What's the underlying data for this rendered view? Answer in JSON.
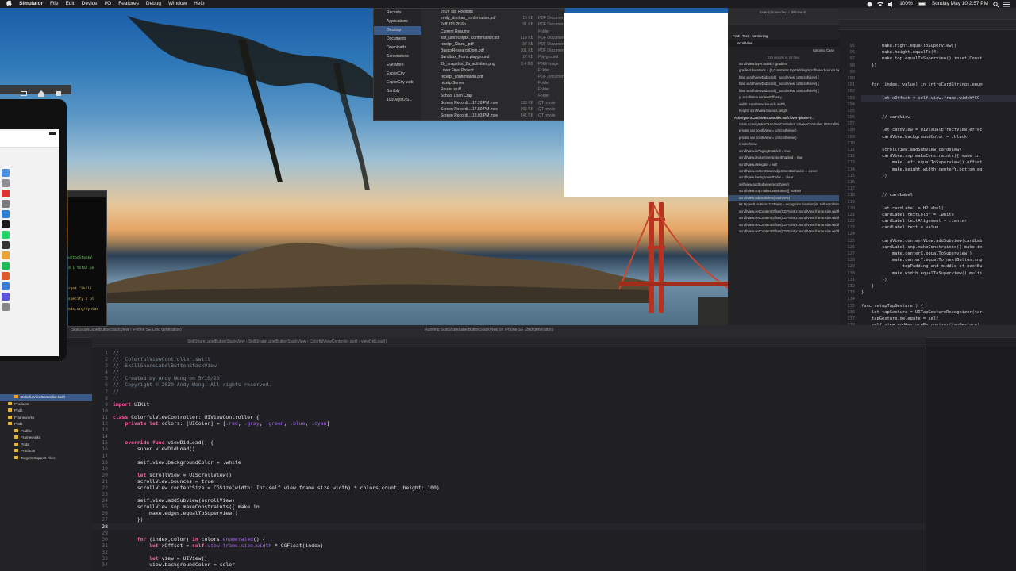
{
  "menubar": {
    "apple": "",
    "app_name": "Simulator",
    "items": [
      "File",
      "Edit",
      "Device",
      "I/O",
      "Features",
      "Debug",
      "Window",
      "Help"
    ],
    "battery": "100%",
    "clock": "Sunday May 10  2:57 PM"
  },
  "finder": {
    "sidebar": [
      "Recents",
      "Applications",
      "Desktop",
      "Documents",
      "Downloads",
      "Screenshots",
      "EverMore",
      "ExplorCity",
      "ExplorCity-web",
      "Baritbly",
      "100DaysOfS..."
    ],
    "selected": "Desktop",
    "files": [
      {
        "name": "2019 Tax Receipts",
        "size": "",
        "kind": ""
      },
      {
        "name": "emily_doohan_confirmation.pdf",
        "size": "15 KB",
        "kind": "PDF Document"
      },
      {
        "name": "2aff1f15.2f16b",
        "size": "51 KB",
        "kind": "PDF Document"
      },
      {
        "name": "Current Resume",
        "size": "",
        "kind": "Folder"
      },
      {
        "name": "sist_umreceiptx...confirmation.pdf",
        "size": "119 KB",
        "kind": "PDF Document"
      },
      {
        "name": "receipt_Cbiza_.pdf",
        "size": "57 KB",
        "kind": "PDF Document"
      },
      {
        "name": "BasicsResearchDoin.pdf",
        "size": "101 KB",
        "kind": "PDF Document"
      },
      {
        "name": "Sandbox_Frans.playground",
        "size": "17 KB",
        "kind": "Playground"
      },
      {
        "name": "2b_snapshot_2a_activities.png",
        "size": "3.4 MB",
        "kind": "PNG image"
      },
      {
        "name": "Lover Final Project",
        "size": "",
        "kind": "Folder"
      },
      {
        "name": "receipt_confirmation.pdf",
        "size": "",
        "kind": "PDF Document"
      },
      {
        "name": "receiptServer",
        "size": "",
        "kind": "Folder"
      },
      {
        "name": "Router stuff",
        "size": "",
        "kind": "Folder"
      },
      {
        "name": "School Loan Crap",
        "size": "",
        "kind": "Folder"
      },
      {
        "name": "Screen Recordi....17.28 PM.mov",
        "size": "533 KB",
        "kind": "QT movie"
      },
      {
        "name": "Screen Recordi....17.50 PM.mov",
        "size": "995 KB",
        "kind": "QT movie"
      },
      {
        "name": "Screen Recordi....18.03 PM.mov",
        "size": "341 KB",
        "kind": "QT movie"
      },
      {
        "name": "Screen Recordi....18.23 PM.mov",
        "size": "265 KB",
        "kind": "QT movie"
      }
    ]
  },
  "xcode_right": {
    "scheme": "lover-iphone-dev",
    "device": "iPhone 8",
    "find_label": "Find",
    "find_modes": [
      "Text",
      "Containing"
    ],
    "query": "scrollView",
    "ignoring_case": "Ignoring Case",
    "results_count": "225 results in 19 files",
    "results": [
      "scrollView.layer.mask = gradient",
      "gradient.locations = [0,Constants.topPadding/scrollView.bounds.height as NSNumber,0.1,0.8,1]",
      "func scrollViewDidScroll(_ scrollView: UIScrollView) {",
      "func scrollViewDidScroll(_ scrollView: UIScrollView) {",
      "func scrollViewDidScroll(_ scrollView: UIScrollView) {",
      "y: scrollView.contentOffset.y,",
      "width: scrollView.bounds.width,",
      "height: scrollView.bounds.height",
      "ActivityIntroCardViewController.swift  lover-iphone-s...",
      "class ActivityIntroCardViewController: UIViewController, UIScrollViewDelegate, UIGestureRecognizerDelegate {",
      "private var scrollView = UIScrollView()",
      "private var scrollView = UIScrollView()",
      "// scrollView",
      "scrollView.isPagingEnabled = true",
      "scrollView.isUserInteractionEnabled = true",
      "scrollView.delegate = self",
      "scrollView.contentInsetAdjustmentBehavior = .never",
      "scrollView.backgroundColor = .clear",
      "self.view.addSubview(scrollView)",
      "scrollView.snp.makeConstraints({ make in",
      "scrollView.addSubview(cardView)",
      "let tappedLocation: CGPoint = recognizer.location(in: self.scrollView)",
      "scrollView.setContentOffset(CGPoint(x: scrollView.frame.size.width * CGFloat(currentIndex + 1), y: 0), animated: true)",
      "scrollView.setContentOffset(CGPoint(x: scrollView.frame.size.width * CGFloat(currentIndex - 1), y: 0), animated: true)",
      "scrollView.setContentOffset(CGPoint(x: scrollView.frame.size.width * CGFloat(currentIndex + 1), y: 0), animated: true)",
      "scrollView.setContentOffset(CGPoint(x: scrollView.frame.size.width * CGFloat(currentIndex + 1), y: 0))"
    ],
    "code_lines": [
      {
        "n": "95",
        "t": "        make.right.equalToSuperview()"
      },
      {
        "n": "96",
        "t": "        make.height.equalTo(4)"
      },
      {
        "n": "97",
        "t": "        make.top.equalToSuperview().inset(Const"
      },
      {
        "n": "98",
        "t": "    })"
      },
      {
        "n": "99",
        "t": ""
      },
      {
        "n": "100",
        "t": ""
      },
      {
        "n": "101",
        "t": "    for (index, value) in introCardStrings.enum"
      },
      {
        "n": "102",
        "t": ""
      },
      {
        "n": "103",
        "t": "        let xOffset = self.view.frame.width*CG"
      },
      {
        "n": "104",
        "t": ""
      },
      {
        "n": "105",
        "t": ""
      },
      {
        "n": "106",
        "t": "        // cardView"
      },
      {
        "n": "107",
        "t": ""
      },
      {
        "n": "108",
        "t": "        let cardView = UIVisualEffectView(effec"
      },
      {
        "n": "109",
        "t": "        cardView.backgroundColor = .black"
      },
      {
        "n": "110",
        "t": ""
      },
      {
        "n": "111",
        "t": "        scrollView.addSubview(cardView)"
      },
      {
        "n": "112",
        "t": "        cardView.snp.makeConstraints({ make in"
      },
      {
        "n": "113",
        "t": "            make.left.equalToSuperview().offset"
      },
      {
        "n": "114",
        "t": "            make.height.width.centerY.bottom.eq"
      },
      {
        "n": "115",
        "t": "        })"
      },
      {
        "n": "116",
        "t": ""
      },
      {
        "n": "117",
        "t": ""
      },
      {
        "n": "118",
        "t": "        // cardLabel"
      },
      {
        "n": "119",
        "t": ""
      },
      {
        "n": "120",
        "t": "        let cardLabel = H2Label()"
      },
      {
        "n": "121",
        "t": "        cardLabel.textColor = .white"
      },
      {
        "n": "122",
        "t": "        cardLabel.textAlignment = .center"
      },
      {
        "n": "123",
        "t": "        cardLabel.text = value"
      },
      {
        "n": "124",
        "t": ""
      },
      {
        "n": "125",
        "t": "        cardView.contentView.addSubview(cardLab"
      },
      {
        "n": "126",
        "t": "        cardLabel.snp.makeConstraints({ make in"
      },
      {
        "n": "127",
        "t": "            make.centerX.equalToSuperview()"
      },
      {
        "n": "128",
        "t": "            make.centerY.equalTo(nextButton.snp"
      },
      {
        "n": "129",
        "t": "                topPadding and middle of nextBu"
      },
      {
        "n": "130",
        "t": "            make.width.equalToSuperview().multi"
      },
      {
        "n": "131",
        "t": "        })"
      },
      {
        "n": "132",
        "t": "    }"
      },
      {
        "n": "133",
        "t": "}"
      },
      {
        "n": "134",
        "t": ""
      },
      {
        "n": "135",
        "t": "func setupTapGesture() {"
      },
      {
        "n": "136",
        "t": "    let tapGesture = UITapGestureRecognizer(tar"
      },
      {
        "n": "137",
        "t": "    tapGesture.delegate = self"
      },
      {
        "n": "138",
        "t": "    self.view.addGestureRecognizer(tapGesture)"
      }
    ]
  },
  "xcode_bottom": {
    "breadcrumb": [
      "SkillShareLabelButtonStackView",
      "SkillShareLabelButtonStackView",
      "ColorfulViewController.swift",
      "viewDidLoad()"
    ],
    "scheme": "SkillShareLabelButtonStackView",
    "device": "iPhone SE (2nd generation)",
    "status": "Running SkillShareLabelButtonStackView on iPhone SE (2nd generation)",
    "navigator": [
      {
        "label": "ColorfulViewController.swift",
        "indent": 1,
        "selected": true
      },
      {
        "label": "Products",
        "indent": 0,
        "selected": false
      },
      {
        "label": "Pods",
        "indent": 0,
        "selected": false
      },
      {
        "label": "Frameworks",
        "indent": 0,
        "selected": false
      },
      {
        "label": "Pods",
        "indent": 0,
        "selected": false
      },
      {
        "label": "Podfile",
        "indent": 1,
        "selected": false
      },
      {
        "label": "Frameworks",
        "indent": 1,
        "selected": false
      },
      {
        "label": "Pods",
        "indent": 1,
        "selected": false
      },
      {
        "label": "Products",
        "indent": 1,
        "selected": false
      },
      {
        "label": "Targets Support Files",
        "indent": 1,
        "selected": false
      }
    ],
    "current_line": "28",
    "code_lines": [
      {
        "n": "1",
        "t": "//"
      },
      {
        "n": "2",
        "t": "//  ColorfulViewController.swift"
      },
      {
        "n": "3",
        "t": "//  SkillShareLabelButtonStackView"
      },
      {
        "n": "4",
        "t": "//"
      },
      {
        "n": "5",
        "t": "//  Created by Andy Wong on 5/10/20."
      },
      {
        "n": "6",
        "t": "//  Copyright © 2020 Andy Wong. All rights reserved."
      },
      {
        "n": "7",
        "t": "//"
      },
      {
        "n": "8",
        "t": ""
      },
      {
        "n": "9",
        "t": "import UIKit"
      },
      {
        "n": "10",
        "t": ""
      },
      {
        "n": "11",
        "t": "class ColorfulViewController: UIViewController {"
      },
      {
        "n": "12",
        "t": "    private let colors: [UIColor] = [.red, .gray, .green, .blue, .cyan]"
      },
      {
        "n": "13",
        "t": ""
      },
      {
        "n": "14",
        "t": ""
      },
      {
        "n": "15",
        "t": "    override func viewDidLoad() {"
      },
      {
        "n": "16",
        "t": "        super.viewDidLoad()"
      },
      {
        "n": "17",
        "t": ""
      },
      {
        "n": "18",
        "t": "        self.view.backgroundColor = .white"
      },
      {
        "n": "19",
        "t": ""
      },
      {
        "n": "20",
        "t": "        let scrollView = UIScrollView()"
      },
      {
        "n": "21",
        "t": "        scrollView.bounces = true"
      },
      {
        "n": "22",
        "t": "        scrollView.contentSize = CGSize(width: Int(self.view.frame.size.width) * colors.count, height: 100)"
      },
      {
        "n": "23",
        "t": ""
      },
      {
        "n": "24",
        "t": "        self.view.addSubview(scrollView)"
      },
      {
        "n": "25",
        "t": "        scrollView.snp.makeConstraints({ make in"
      },
      {
        "n": "26",
        "t": "            make.edges.equalToSuperview()"
      },
      {
        "n": "27",
        "t": "        })"
      },
      {
        "n": "28",
        "t": ""
      },
      {
        "n": "29",
        "t": ""
      },
      {
        "n": "30",
        "t": "        for (index,color) in colors.enumerated() {"
      },
      {
        "n": "31",
        "t": "            let xOffset = self.view.frame.size.width * CGFloat(index)"
      },
      {
        "n": "32",
        "t": ""
      },
      {
        "n": "33",
        "t": "            let view = UIView()"
      },
      {
        "n": "34",
        "t": "            view.backgroundColor = color"
      }
    ]
  },
  "terminal": {
    "lines": [
      "uttonStackV",
      "d 1 total po",
      "",
      "rget 'Skill",
      " specify a pl",
      "ods.org/syntax"
    ]
  },
  "colors": {
    "menubar_bg": "#1d1d1f",
    "editor_bg": "#1f1f24",
    "keyword": "#fc5fa3",
    "comment": "#7f8c98",
    "type": "#d0a8ff",
    "string": "#fc6a5d",
    "number": "#d0bf69",
    "search_highlight": "#e4d35c"
  }
}
